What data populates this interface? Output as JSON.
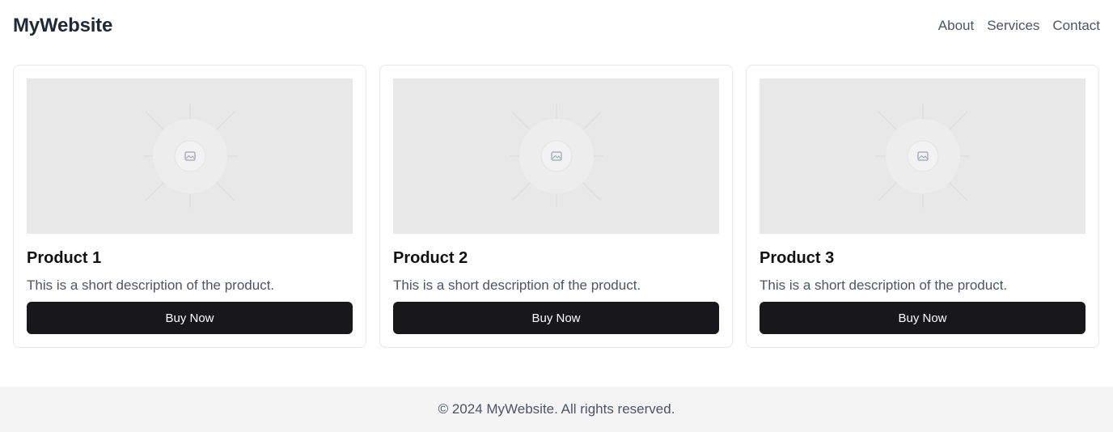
{
  "header": {
    "brand": "MyWebsite",
    "nav": [
      "About",
      "Services",
      "Contact"
    ]
  },
  "products": [
    {
      "title": "Product 1",
      "description": "This is a short description of the product.",
      "button": "Buy Now",
      "image_icon": "image-placeholder-icon"
    },
    {
      "title": "Product 2",
      "description": "This is a short description of the product.",
      "button": "Buy Now",
      "image_icon": "image-placeholder-icon"
    },
    {
      "title": "Product 3",
      "description": "This is a short description of the product.",
      "button": "Buy Now",
      "image_icon": "image-placeholder-icon"
    }
  ],
  "footer": {
    "text": "© 2024 MyWebsite. All rights reserved."
  },
  "colors": {
    "button_bg": "#18181b",
    "footer_bg": "#f4f4f4",
    "placeholder_bg": "#e8e8e8"
  }
}
